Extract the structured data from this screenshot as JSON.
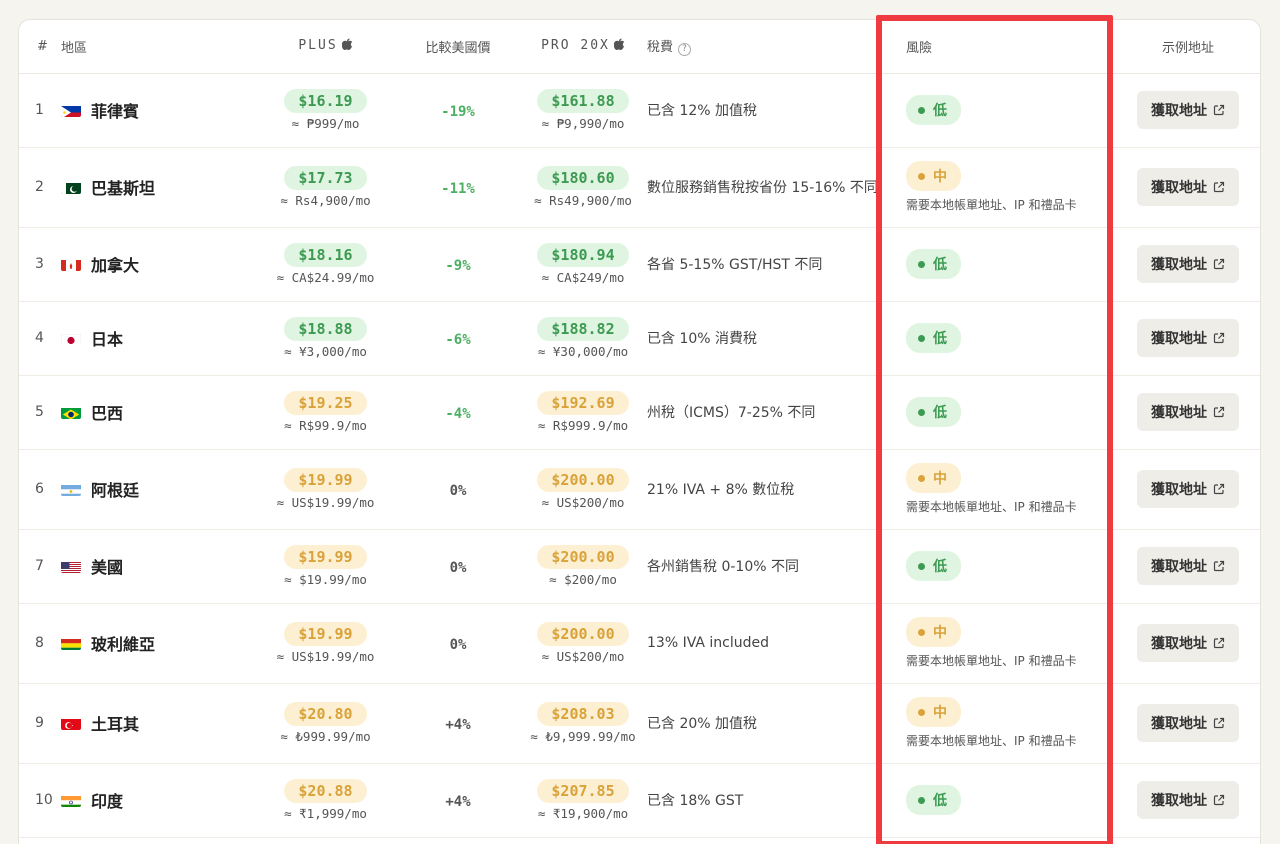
{
  "headers": {
    "num": "#",
    "region": "地區",
    "plus": "PLUS",
    "compare": "比較美國價",
    "pro": "PRO 20X",
    "tax": "稅費",
    "risk": "風險",
    "address": "示例地址"
  },
  "button_label": "獲取地址",
  "colors": {
    "green": "#3d9a52",
    "yellow": "#d9a23a",
    "highlight": "#ef3b3f"
  },
  "rows": [
    {
      "num": "1",
      "flag": "ph",
      "region": "菲律賓",
      "plus": "$16.19",
      "plus_local": "≈ ₱999/mo",
      "plus_color": "green",
      "diff": "-19%",
      "diff_type": "neg",
      "pro": "$161.88",
      "pro_local": "≈ ₱9,990/mo",
      "pro_color": "green",
      "tax": "已含 12% 加值稅",
      "risk": "低",
      "risk_level": "low",
      "risk_note": ""
    },
    {
      "num": "2",
      "flag": "pk",
      "region": "巴基斯坦",
      "plus": "$17.73",
      "plus_local": "≈ Rs4,900/mo",
      "plus_color": "green",
      "diff": "-11%",
      "diff_type": "neg",
      "pro": "$180.60",
      "pro_local": "≈ Rs49,900/mo",
      "pro_color": "green",
      "tax": "數位服務銷售稅按省份 15-16% 不同",
      "risk": "中",
      "risk_level": "mid",
      "risk_note": "需要本地帳單地址、IP 和禮品卡"
    },
    {
      "num": "3",
      "flag": "ca",
      "region": "加拿大",
      "plus": "$18.16",
      "plus_local": "≈ CA$24.99/mo",
      "plus_color": "green",
      "diff": "-9%",
      "diff_type": "neg",
      "pro": "$180.94",
      "pro_local": "≈ CA$249/mo",
      "pro_color": "green",
      "tax": "各省 5-15% GST/HST 不同",
      "risk": "低",
      "risk_level": "low",
      "risk_note": ""
    },
    {
      "num": "4",
      "flag": "jp",
      "region": "日本",
      "plus": "$18.88",
      "plus_local": "≈ ¥3,000/mo",
      "plus_color": "green",
      "diff": "-6%",
      "diff_type": "neg",
      "pro": "$188.82",
      "pro_local": "≈ ¥30,000/mo",
      "pro_color": "green",
      "tax": "已含 10% 消費稅",
      "risk": "低",
      "risk_level": "low",
      "risk_note": ""
    },
    {
      "num": "5",
      "flag": "br",
      "region": "巴西",
      "plus": "$19.25",
      "plus_local": "≈ R$99.9/mo",
      "plus_color": "yellow",
      "diff": "-4%",
      "diff_type": "neg",
      "pro": "$192.69",
      "pro_local": "≈ R$999.9/mo",
      "pro_color": "yellow",
      "tax": "州稅（ICMS）7-25% 不同",
      "risk": "低",
      "risk_level": "low",
      "risk_note": ""
    },
    {
      "num": "6",
      "flag": "ar",
      "region": "阿根廷",
      "plus": "$19.99",
      "plus_local": "≈ US$19.99/mo",
      "plus_color": "yellow",
      "diff": "0%",
      "diff_type": "zero",
      "pro": "$200.00",
      "pro_local": "≈ US$200/mo",
      "pro_color": "yellow",
      "tax": "21% IVA + 8% 數位稅",
      "risk": "中",
      "risk_level": "mid",
      "risk_note": "需要本地帳單地址、IP 和禮品卡"
    },
    {
      "num": "7",
      "flag": "us",
      "region": "美國",
      "plus": "$19.99",
      "plus_local": "≈ $19.99/mo",
      "plus_color": "yellow",
      "diff": "0%",
      "diff_type": "zero",
      "pro": "$200.00",
      "pro_local": "≈ $200/mo",
      "pro_color": "yellow",
      "tax": "各州銷售稅 0-10% 不同",
      "risk": "低",
      "risk_level": "low",
      "risk_note": ""
    },
    {
      "num": "8",
      "flag": "bo",
      "region": "玻利維亞",
      "plus": "$19.99",
      "plus_local": "≈ US$19.99/mo",
      "plus_color": "yellow",
      "diff": "0%",
      "diff_type": "zero",
      "pro": "$200.00",
      "pro_local": "≈ US$200/mo",
      "pro_color": "yellow",
      "tax": "13% IVA included",
      "risk": "中",
      "risk_level": "mid",
      "risk_note": "需要本地帳單地址、IP 和禮品卡"
    },
    {
      "num": "9",
      "flag": "tr",
      "region": "土耳其",
      "plus": "$20.80",
      "plus_local": "≈ ₺999.99/mo",
      "plus_color": "yellow",
      "diff": "+4%",
      "diff_type": "pos",
      "pro": "$208.03",
      "pro_local": "≈ ₺9,999.99/mo",
      "pro_color": "yellow",
      "tax": "已含 20% 加值稅",
      "risk": "中",
      "risk_level": "mid",
      "risk_note": "需要本地帳單地址、IP 和禮品卡"
    },
    {
      "num": "10",
      "flag": "in",
      "region": "印度",
      "plus": "$20.88",
      "plus_local": "≈ ₹1,999/mo",
      "plus_color": "yellow",
      "diff": "+4%",
      "diff_type": "pos",
      "pro": "$207.85",
      "pro_local": "≈ ₹19,900/mo",
      "pro_color": "yellow",
      "tax": "已含 18% GST",
      "risk": "低",
      "risk_level": "low",
      "risk_note": ""
    }
  ]
}
